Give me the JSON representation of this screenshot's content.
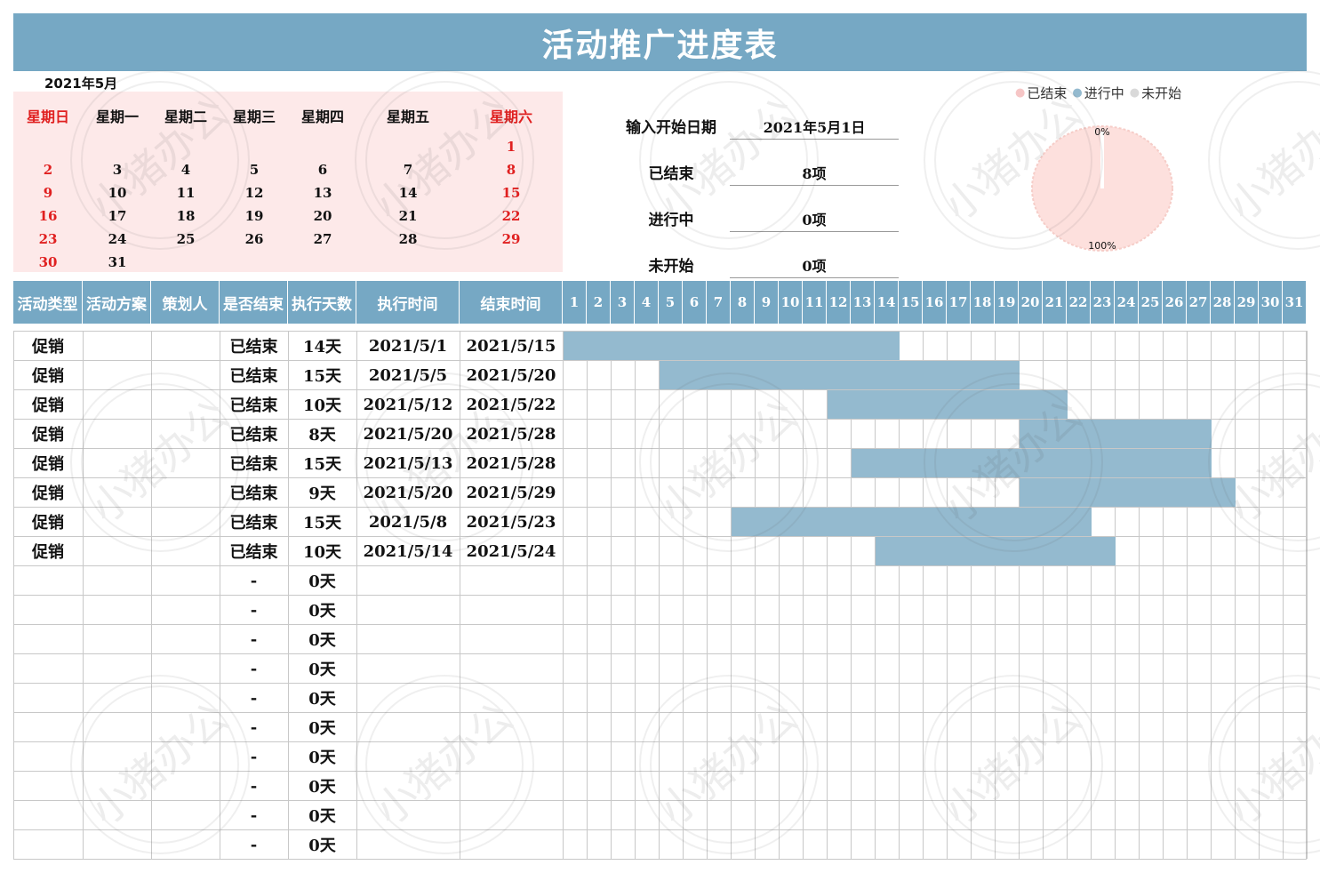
{
  "title": "活动推广进度表",
  "calendar": {
    "month_label": "2021年5月",
    "weekdays": [
      "星期日",
      "星期一",
      "星期二",
      "星期三",
      "星期四",
      "星期五",
      "星期六"
    ],
    "weeks": [
      [
        "",
        "",
        "",
        "",
        "",
        "",
        "1"
      ],
      [
        "2",
        "3",
        "4",
        "5",
        "6",
        "7",
        "8"
      ],
      [
        "9",
        "10",
        "11",
        "12",
        "13",
        "14",
        "15"
      ],
      [
        "16",
        "17",
        "18",
        "19",
        "20",
        "21",
        "22"
      ],
      [
        "23",
        "24",
        "25",
        "26",
        "27",
        "28",
        "29"
      ],
      [
        "30",
        "31",
        "",
        "",
        "",
        "",
        ""
      ]
    ],
    "weekend_color": "#e02020"
  },
  "summary": {
    "start_date_label": "输入开始日期",
    "start_date_value": "2021年5月1日",
    "done_label": "已结束",
    "done_value": "8项",
    "in_progress_label": "进行中",
    "in_progress_value": "0项",
    "not_started_label": "未开始",
    "not_started_value": "0项"
  },
  "pie": {
    "legend": [
      {
        "label": "已结束",
        "color": "#f6c6c6"
      },
      {
        "label": "进行中",
        "color": "#94bacf"
      },
      {
        "label": "未开始",
        "color": "#d9d9d9"
      }
    ],
    "top_label": "0%",
    "bottom_label": "100%",
    "fill_color": "#fde0dd"
  },
  "table": {
    "headers": [
      "活动类型",
      "活动方案",
      "策划人",
      "是否结束",
      "执行天数",
      "执行时间",
      "结束时间"
    ],
    "days": [
      "1",
      "2",
      "3",
      "4",
      "5",
      "6",
      "7",
      "8",
      "9",
      "10",
      "11",
      "12",
      "13",
      "14",
      "15",
      "16",
      "17",
      "18",
      "19",
      "20",
      "21",
      "22",
      "23",
      "24",
      "25",
      "26",
      "27",
      "28",
      "29",
      "30",
      "31"
    ],
    "rows": [
      {
        "type": "促销",
        "plan": "",
        "owner": "",
        "status": "已结束",
        "days": "14天",
        "start": "2021/5/1",
        "end": "2021/5/15",
        "bar_start": 1,
        "bar_end": 15
      },
      {
        "type": "促销",
        "plan": "",
        "owner": "",
        "status": "已结束",
        "days": "15天",
        "start": "2021/5/5",
        "end": "2021/5/20",
        "bar_start": 5,
        "bar_end": 20
      },
      {
        "type": "促销",
        "plan": "",
        "owner": "",
        "status": "已结束",
        "days": "10天",
        "start": "2021/5/12",
        "end": "2021/5/22",
        "bar_start": 12,
        "bar_end": 22
      },
      {
        "type": "促销",
        "plan": "",
        "owner": "",
        "status": "已结束",
        "days": "8天",
        "start": "2021/5/20",
        "end": "2021/5/28",
        "bar_start": 20,
        "bar_end": 28
      },
      {
        "type": "促销",
        "plan": "",
        "owner": "",
        "status": "已结束",
        "days": "15天",
        "start": "2021/5/13",
        "end": "2021/5/28",
        "bar_start": 13,
        "bar_end": 28
      },
      {
        "type": "促销",
        "plan": "",
        "owner": "",
        "status": "已结束",
        "days": "9天",
        "start": "2021/5/20",
        "end": "2021/5/29",
        "bar_start": 20,
        "bar_end": 29
      },
      {
        "type": "促销",
        "plan": "",
        "owner": "",
        "status": "已结束",
        "days": "15天",
        "start": "2021/5/8",
        "end": "2021/5/23",
        "bar_start": 8,
        "bar_end": 23
      },
      {
        "type": "促销",
        "plan": "",
        "owner": "",
        "status": "已结束",
        "days": "10天",
        "start": "2021/5/14",
        "end": "2021/5/24",
        "bar_start": 14,
        "bar_end": 24
      },
      {
        "type": "",
        "plan": "",
        "owner": "",
        "status": "-",
        "days": "0天",
        "start": "",
        "end": ""
      },
      {
        "type": "",
        "plan": "",
        "owner": "",
        "status": "-",
        "days": "0天",
        "start": "",
        "end": ""
      },
      {
        "type": "",
        "plan": "",
        "owner": "",
        "status": "-",
        "days": "0天",
        "start": "",
        "end": ""
      },
      {
        "type": "",
        "plan": "",
        "owner": "",
        "status": "-",
        "days": "0天",
        "start": "",
        "end": ""
      },
      {
        "type": "",
        "plan": "",
        "owner": "",
        "status": "-",
        "days": "0天",
        "start": "",
        "end": ""
      },
      {
        "type": "",
        "plan": "",
        "owner": "",
        "status": "-",
        "days": "0天",
        "start": "",
        "end": ""
      },
      {
        "type": "",
        "plan": "",
        "owner": "",
        "status": "-",
        "days": "0天",
        "start": "",
        "end": ""
      },
      {
        "type": "",
        "plan": "",
        "owner": "",
        "status": "-",
        "days": "0天",
        "start": "",
        "end": ""
      },
      {
        "type": "",
        "plan": "",
        "owner": "",
        "status": "-",
        "days": "0天",
        "start": "",
        "end": ""
      },
      {
        "type": "",
        "plan": "",
        "owner": "",
        "status": "-",
        "days": "0天",
        "start": "",
        "end": ""
      }
    ],
    "bar_color": "#94bacf"
  },
  "watermark": "小猪办公"
}
